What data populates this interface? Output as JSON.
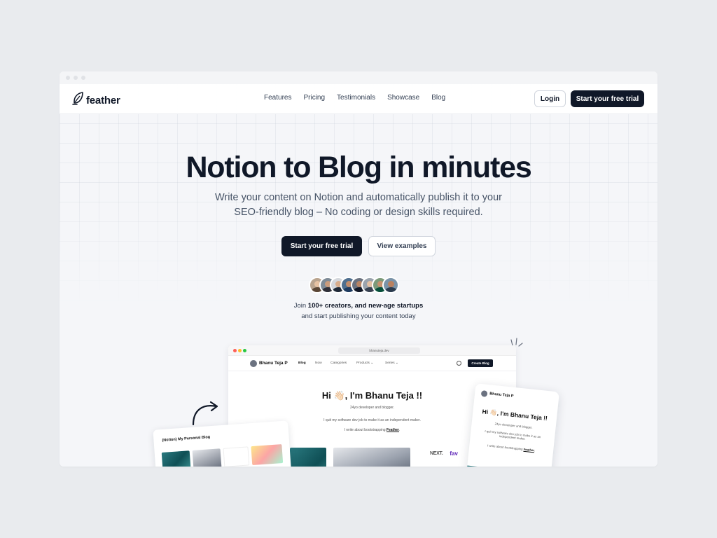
{
  "brand": {
    "name": "feather",
    "logo_icon": "feather-icon"
  },
  "nav": {
    "links": [
      "Features",
      "Pricing",
      "Testimonials",
      "Showcase",
      "Blog"
    ],
    "login_label": "Login",
    "trial_label": "Start your free trial"
  },
  "hero": {
    "title": "Notion to Blog in minutes",
    "subtitle_line1": "Write your content on Notion and automatically publish it to your",
    "subtitle_line2": "SEO-friendly blog – No coding or design skills required.",
    "primary_cta": "Start your free trial",
    "secondary_cta": "View examples"
  },
  "social_proof": {
    "join_prefix": "Join ",
    "join_bold": "100+ creators, and new-age startups",
    "join_line2": "and start publishing your content today"
  },
  "mockup": {
    "url": "bhanuteja.dev",
    "author": "Bhanu Teja P",
    "nav_links": [
      "Blog",
      "Now",
      "Categories",
      "Products ⌄",
      "Series ⌄"
    ],
    "create_blog_label": "Create Blog",
    "heading": "Hi 👋🏻, I'm Bhanu Teja !!",
    "line1": "24yo developer and blogger.",
    "line2": "I quit my software dev job to make it as an independent maker.",
    "line3_prefix": "I write about bootstrapping ",
    "line3_link": "Feather",
    "line3_suffix": "."
  },
  "notion_card": {
    "title": "(Notion) My Personal Blog"
  },
  "mobile_card": {
    "author": "Bhanu Teja P",
    "heading": "Hi 👋🏻, I'm Bhanu Teja !!",
    "line1": "24yo developer and blogger.",
    "line2": "I quit my software dev job to make it as an independent maker.",
    "line3_prefix": "I write about bootstrapping ",
    "line3_link": "Feather",
    "line3_suffix": "."
  },
  "logos": {
    "next": "NEXT.",
    "fav": "fav"
  },
  "colors": {
    "primary": "#101828",
    "background": "#e9ebee",
    "text_muted": "#475467"
  }
}
